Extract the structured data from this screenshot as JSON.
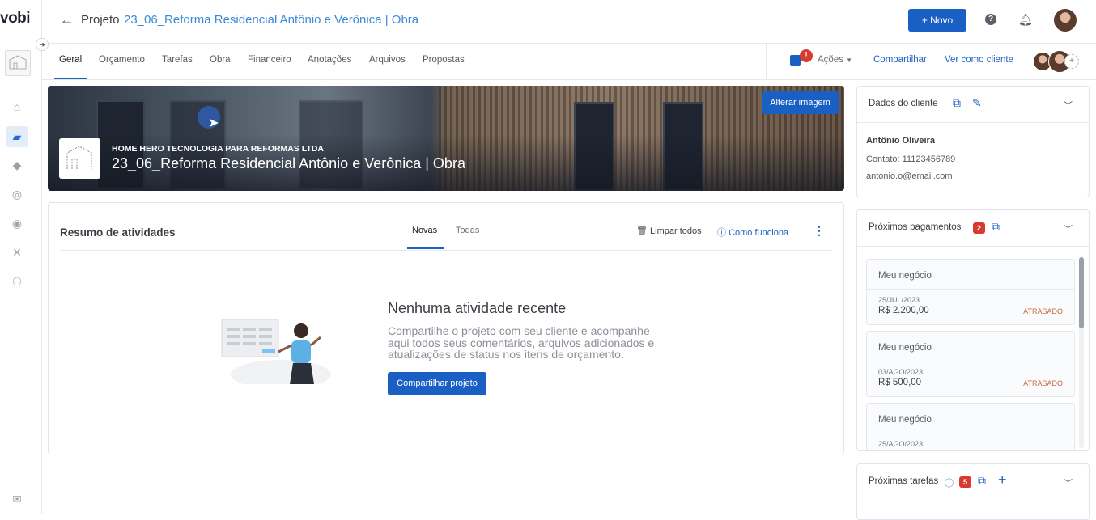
{
  "app": {
    "logo": "vobi"
  },
  "header": {
    "title_prefix": "Projeto",
    "project_name": "23_06_Reforma Residencial Antônio e Verônica | Obra",
    "new_button": "+ Novo"
  },
  "tabs": [
    "Geral",
    "Orçamento",
    "Tarefas",
    "Obra",
    "Financeiro",
    "Anotações",
    "Arquivos",
    "Propostas"
  ],
  "toolbar": {
    "actions_badge": "!",
    "actions_label": "Ações",
    "share_label": "Compartilhar",
    "view_as_client": "Ver como cliente"
  },
  "hero": {
    "change_image": "Alterar imagem",
    "company": "HOME HERO TECNOLOGIA PARA REFORMAS LTDA",
    "title": "23_06_Reforma Residencial Antônio e Verônica | Obra"
  },
  "activity": {
    "title": "Resumo de atividades",
    "tab_new": "Novas",
    "tab_all": "Todas",
    "clear_all": "Limpar todos",
    "how_it_works": "Como funciona",
    "empty_title": "Nenhuma atividade recente",
    "empty_text_1": "Compartilhe o projeto com seu cliente e acompanhe",
    "empty_text_2": "aqui todos seus comentários, arquivos adicionados e",
    "empty_text_3": "atualizações de status nos itens de orçamento.",
    "share_button": "Compartilhar projeto"
  },
  "client": {
    "title": "Dados do cliente",
    "name": "Antônio Oliveira",
    "contact": "Contato: 11123456789",
    "email": "antonio.o@email.com"
  },
  "payments": {
    "title": "Próximos pagamentos",
    "count": "2",
    "items": [
      {
        "title": "Meu negócio",
        "date": "25/JUL/2023",
        "value": "R$ 2.200,00",
        "status": "ATRASADO"
      },
      {
        "title": "Meu negócio",
        "date": "03/AGO/2023",
        "value": "R$ 500,00",
        "status": "ATRASADO"
      },
      {
        "title": "Meu negócio",
        "date": "25/AGO/2023",
        "value": "",
        "status": ""
      }
    ]
  },
  "tasks": {
    "title": "Próximas tarefas",
    "count": "5"
  },
  "colors": {
    "primary": "#1a5fc4",
    "link": "#3d8ad8",
    "danger": "#d93a30",
    "overdue": "#c06a3a"
  }
}
